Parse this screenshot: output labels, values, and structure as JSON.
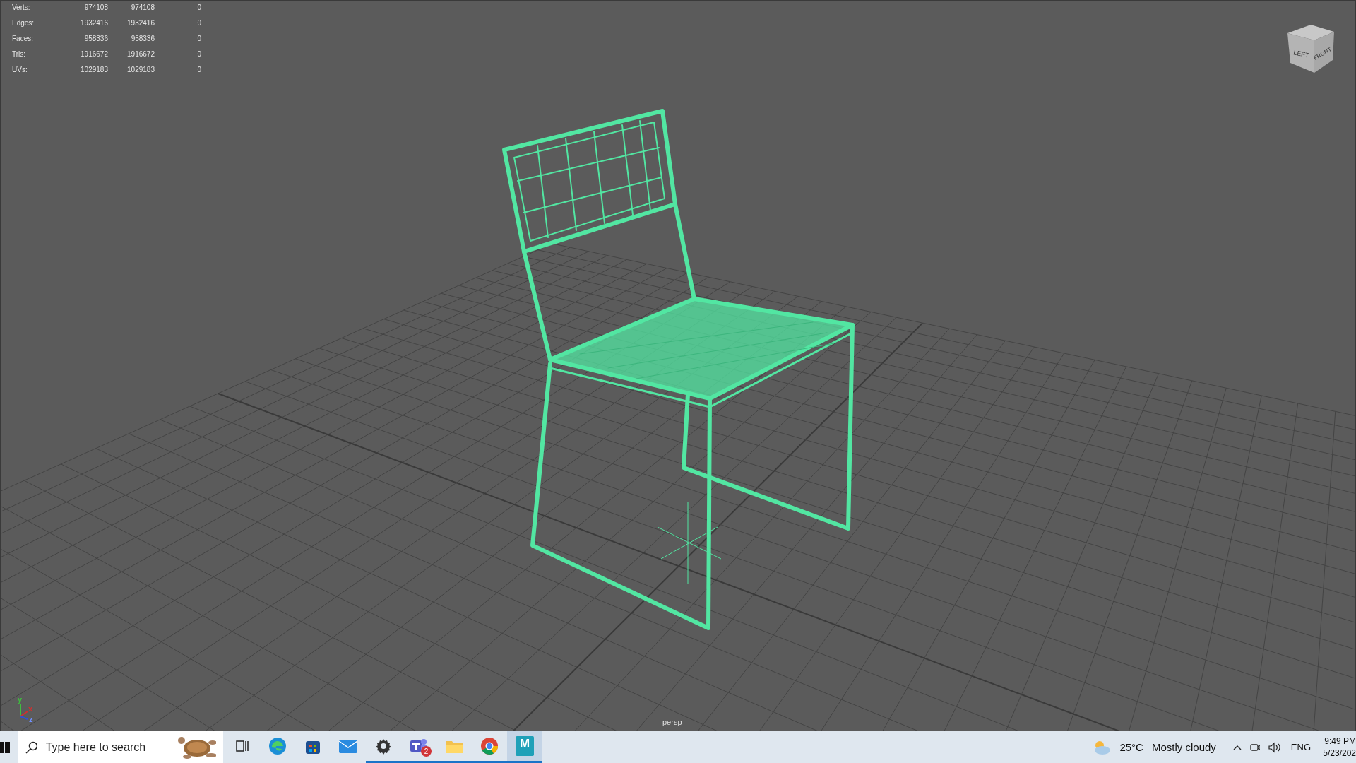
{
  "viewport": {
    "camera_label": "persp",
    "stats": [
      {
        "label": "Verts:",
        "values": [
          "974108",
          "974108",
          "0"
        ]
      },
      {
        "label": "Edges:",
        "values": [
          "1932416",
          "1932416",
          "0"
        ]
      },
      {
        "label": "Faces:",
        "values": [
          "958336",
          "958336",
          "0"
        ]
      },
      {
        "label": "Tris:",
        "values": [
          "1916672",
          "1916672",
          "0"
        ]
      },
      {
        "label": "UVs:",
        "values": [
          "1029183",
          "1029183",
          "0"
        ]
      }
    ],
    "view_cube": {
      "left_face": "LEFT",
      "front_face": "FRONT"
    },
    "axes": [
      {
        "label": "y",
        "color": "#3fbf3f"
      },
      {
        "label": "x",
        "color": "#d03030"
      },
      {
        "label": "z",
        "color": "#3050d8"
      }
    ]
  },
  "taskbar": {
    "search": {
      "placeholder": "Type here to search"
    },
    "apps": [
      {
        "kind": "taskview",
        "running": false,
        "active": false
      },
      {
        "kind": "edge",
        "running": false,
        "active": false
      },
      {
        "kind": "store",
        "running": false,
        "active": false
      },
      {
        "kind": "mail",
        "running": false,
        "active": false
      },
      {
        "kind": "settings",
        "running": true,
        "active": false
      },
      {
        "kind": "teams",
        "running": true,
        "active": false,
        "badge": "2"
      },
      {
        "kind": "explorer",
        "running": true,
        "active": false
      },
      {
        "kind": "chrome",
        "running": true,
        "active": false
      },
      {
        "kind": "maya",
        "running": true,
        "active": true,
        "label": "M"
      }
    ],
    "weather": {
      "temperature": "25°C",
      "condition": "Mostly cloudy"
    },
    "language": "ENG",
    "time": "9:49 PM",
    "date": "5/23/202"
  }
}
